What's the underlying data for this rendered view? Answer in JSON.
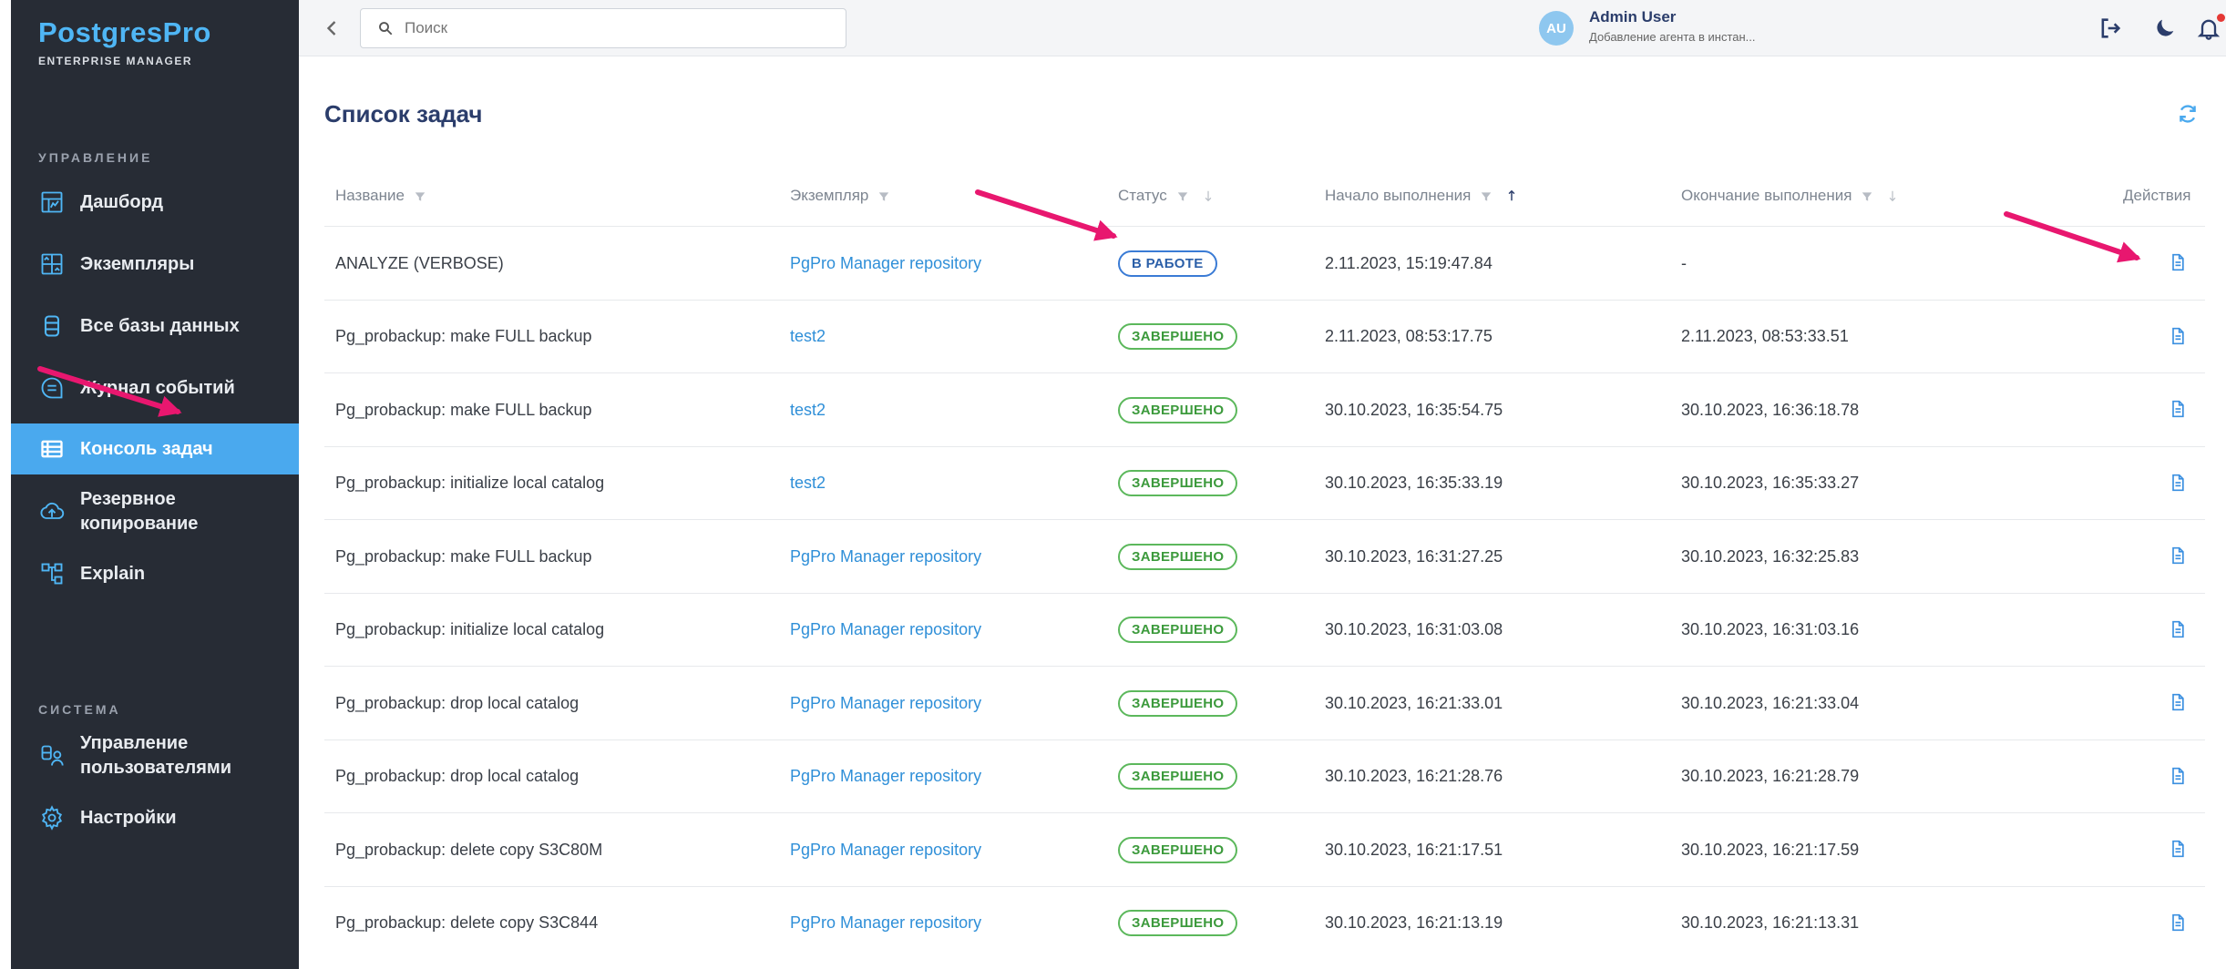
{
  "sidebar": {
    "logo_main": "PostgresPro",
    "logo_sub": "ENTERPRISE MANAGER",
    "section_manage": "УПРАВЛЕНИЕ",
    "section_system": "СИСТЕМА",
    "items": [
      {
        "label": "Дашборд",
        "icon": "dashboard-icon"
      },
      {
        "label": "Экземпляры",
        "icon": "instances-icon"
      },
      {
        "label": "Все базы данных",
        "icon": "database-icon"
      },
      {
        "label": "Журнал событий",
        "icon": "chat-icon"
      },
      {
        "label": "Консоль задач",
        "icon": "list-icon",
        "active": true
      },
      {
        "label": "Резервное копирование",
        "icon": "cloud-upload-icon"
      },
      {
        "label": "Explain",
        "icon": "tree-icon"
      }
    ],
    "system_items": [
      {
        "label": "Управление пользователями",
        "icon": "users-db-icon"
      },
      {
        "label": "Настройки",
        "icon": "gear-icon"
      }
    ]
  },
  "topbar": {
    "search_placeholder": "Поиск",
    "avatar_initials": "AU",
    "user_name": "Admin User",
    "user_sub": "Добавление агента в инстан..."
  },
  "main": {
    "title": "Список задач",
    "columns": [
      "Название",
      "Экземпляр",
      "Статус",
      "Начало выполнения",
      "Окончание выполнения",
      "Действия"
    ],
    "rows": [
      {
        "name": "ANALYZE (VERBOSE)",
        "instance": "PgPro Manager repository",
        "status": "В РАБОТЕ",
        "running": true,
        "start": "2.11.2023, 15:19:47.84",
        "end": "-"
      },
      {
        "name": "Pg_probackup: make FULL backup",
        "instance": "test2",
        "status": "ЗАВЕРШЕНО",
        "running": false,
        "start": "2.11.2023, 08:53:17.75",
        "end": "2.11.2023, 08:53:33.51"
      },
      {
        "name": "Pg_probackup: make FULL backup",
        "instance": "test2",
        "status": "ЗАВЕРШЕНО",
        "running": false,
        "start": "30.10.2023, 16:35:54.75",
        "end": "30.10.2023, 16:36:18.78"
      },
      {
        "name": "Pg_probackup: initialize local catalog",
        "instance": "test2",
        "status": "ЗАВЕРШЕНО",
        "running": false,
        "start": "30.10.2023, 16:35:33.19",
        "end": "30.10.2023, 16:35:33.27"
      },
      {
        "name": "Pg_probackup: make FULL backup",
        "instance": "PgPro Manager repository",
        "status": "ЗАВЕРШЕНО",
        "running": false,
        "start": "30.10.2023, 16:31:27.25",
        "end": "30.10.2023, 16:32:25.83"
      },
      {
        "name": "Pg_probackup: initialize local catalog",
        "instance": "PgPro Manager repository",
        "status": "ЗАВЕРШЕНО",
        "running": false,
        "start": "30.10.2023, 16:31:03.08",
        "end": "30.10.2023, 16:31:03.16"
      },
      {
        "name": "Pg_probackup: drop local catalog",
        "instance": "PgPro Manager repository",
        "status": "ЗАВЕРШЕНО",
        "running": false,
        "start": "30.10.2023, 16:21:33.01",
        "end": "30.10.2023, 16:21:33.04"
      },
      {
        "name": "Pg_probackup: drop local catalog",
        "instance": "PgPro Manager repository",
        "status": "ЗАВЕРШЕНО",
        "running": false,
        "start": "30.10.2023, 16:21:28.76",
        "end": "30.10.2023, 16:21:28.79"
      },
      {
        "name": "Pg_probackup: delete copy S3C80M",
        "instance": "PgPro Manager repository",
        "status": "ЗАВЕРШЕНО",
        "running": false,
        "start": "30.10.2023, 16:21:17.51",
        "end": "30.10.2023, 16:21:17.59"
      },
      {
        "name": "Pg_probackup: delete copy S3C844",
        "instance": "PgPro Manager repository",
        "status": "ЗАВЕРШЕНО",
        "running": false,
        "start": "30.10.2023, 16:21:13.19",
        "end": "30.10.2023, 16:21:13.31"
      }
    ]
  },
  "colors": {
    "accent": "#4aa9ee",
    "sidebar_bg": "#272c35",
    "annotation_arrow": "#e8176f",
    "success": "#5cb85c"
  }
}
